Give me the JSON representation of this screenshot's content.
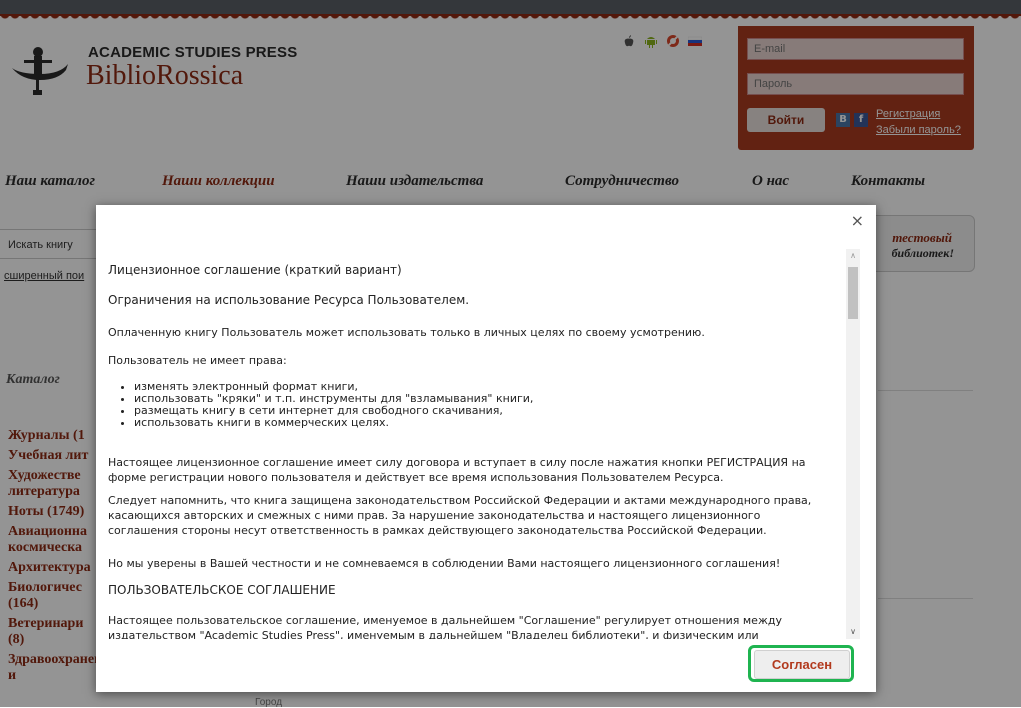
{
  "header": {
    "logo_sup": "ACADEMIC STUDIES PRESS",
    "logo_main": "BiblioRossica",
    "platform_icons": [
      "apple-icon",
      "android-icon",
      "support-icon",
      "russian-flag-icon"
    ]
  },
  "login": {
    "email_placeholder": "E-mail",
    "password_placeholder": "Пароль",
    "login_button": "Войти",
    "social": [
      "B",
      "f"
    ],
    "register_link": "Регистрация",
    "forgot_link": "Забыли пароль?"
  },
  "nav": {
    "items": [
      "Наш каталог",
      "Наши коллекции",
      "Наши издательства",
      "Сотрудничество",
      "О нас",
      "Контакты"
    ]
  },
  "background": {
    "search_placeholder": "Искать книгу",
    "advanced_search": "сширенный пои",
    "catalog_label": "Каталог",
    "catalog_items": [
      "Журналы (1",
      "Учебная лит",
      "Художестве",
      "литература",
      "Ноты (1749)",
      "Авиационна",
      "космическа",
      "Архитектура",
      "Биологичес",
      "(164)",
      "Ветеринари",
      "(8)",
      "Здравоохранение и"
    ],
    "right_box_line1": "тестовый",
    "right_box_line2": "библиотек!",
    "city_label": "Город"
  },
  "modal": {
    "close": "×",
    "title": "Лицензионное соглашение (краткий вариант)",
    "restrictions": "Ограничения на использование Ресурса Пользователем.",
    "p1": "Оплаченную книгу Пользователь может использовать только в личных целях по своему усмотрению.",
    "p2": "Пользователь не имеет права:",
    "bullets": [
      "изменять электронный формат книги,",
      "использовать \"кряки\" и т.п. инструменты для \"взламывания\" книги,",
      "размещать книгу в сети интернет для свободного скачивания,",
      "использовать книги в коммерческих целях."
    ],
    "p3": "Настоящее лицензионное соглашение имеет силу договора и вступает в силу после нажатия кнопки РЕГИСТРАЦИЯ на форме регистрации нового пользователя и действует все время использования Пользователем Ресурса.",
    "p4": "Следует напомнить, что книга защищена законодательством Российской Федерации и актами международного права, касающихся авторских и смежных с ними прав. За нарушение законодательства и настоящего лицензионного соглашения стороны несут ответственность в рамках действующего законодательства Российской Федерации.",
    "p5": "Но мы уверены в Вашей честности и не сомневаемся в соблюдении Вами настоящего лицензионного соглашения!",
    "heading2": "ПОЛЬЗОВАТЕЛЬСКОЕ СОГЛАШЕНИЕ",
    "p6": "Настоящее пользовательское соглашение, именуемое в дальнейшем \"Соглашение\" регулирует отношения между издательством \"Academic Studies Press\", именуемым в дальнейшем \"Владелец библиотеки\", и физическим или",
    "agree_button": "Согласен"
  },
  "colors": {
    "brand_red": "#8e2a14",
    "login_bg": "#a93c20",
    "highlight_green": "#1fb450"
  }
}
